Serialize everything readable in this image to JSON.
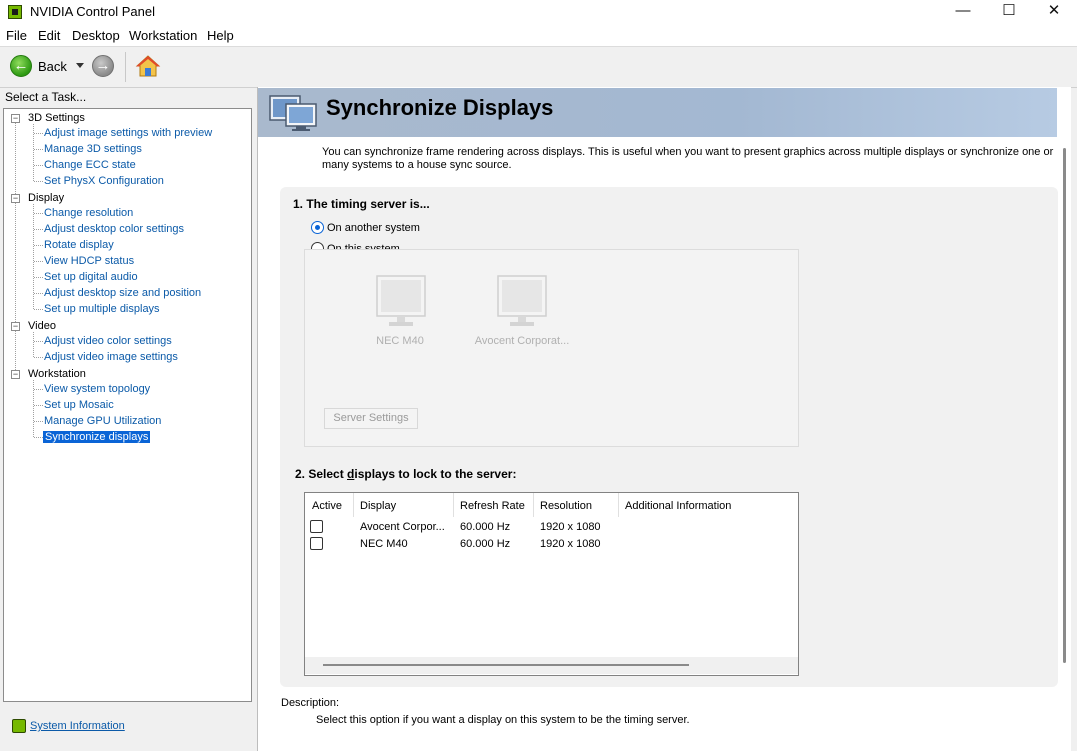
{
  "window": {
    "title": "NVIDIA Control Panel",
    "minimize_glyph": "—",
    "maximize_glyph": "☐",
    "close_glyph": "✕"
  },
  "menu": [
    "File",
    "Edit",
    "Desktop",
    "Workstation",
    "Help"
  ],
  "toolbar": {
    "back_label": "Back",
    "icons": [
      "back-arrow-icon",
      "dropdown-arrow-icon",
      "forward-arrow-icon",
      "home-icon"
    ]
  },
  "sidebar": {
    "task_label": "Select a Task...",
    "categories": [
      {
        "label": "3D Settings",
        "items": [
          "Adjust image settings with preview",
          "Manage 3D settings",
          "Change ECC state",
          "Set PhysX Configuration"
        ]
      },
      {
        "label": "Display",
        "items": [
          "Change resolution",
          "Adjust desktop color settings",
          "Rotate display",
          "View HDCP status",
          "Set up digital audio",
          "Adjust desktop size and position",
          "Set up multiple displays"
        ]
      },
      {
        "label": "Video",
        "items": [
          "Adjust video color settings",
          "Adjust video image settings"
        ]
      },
      {
        "label": "Workstation",
        "items": [
          "View system topology",
          "Set up Mosaic",
          "Manage GPU Utilization",
          "Synchronize displays"
        ]
      }
    ],
    "selected_item": "Synchronize displays",
    "expander_glyph": "−",
    "system_info_link": "System Information"
  },
  "page": {
    "title": "Synchronize Displays",
    "intro": "You can synchronize frame rendering across displays. This is useful when you want to present graphics across multiple displays or synchronize one or many systems to a house sync source.",
    "section1": {
      "title": "1. The timing server is...",
      "option_another": "On another system",
      "option_this": "On this system",
      "selected": "On another system",
      "displays": [
        "NEC M40",
        "Avocent Corporat..."
      ],
      "server_settings_button": "Server Settings"
    },
    "section2": {
      "title_prefix": "2. Select ",
      "title_underlined": "d",
      "title_suffix": "isplays to lock to the server:",
      "columns": [
        "Active",
        "Display",
        "Refresh Rate",
        "Resolution",
        "Additional Information"
      ],
      "rows": [
        {
          "active": false,
          "display": "Avocent Corpor...",
          "refresh": "60.000 Hz",
          "resolution": "1920 x 1080",
          "info": ""
        },
        {
          "active": false,
          "display": "NEC M40",
          "refresh": "60.000 Hz",
          "resolution": "1920 x 1080",
          "info": ""
        }
      ]
    },
    "description_label": "Description:",
    "description_text": "Select this option if you want a display on this system to be the timing server."
  },
  "colors": {
    "accent": "#0a64d6",
    "link": "#0b5aa8",
    "nvidia_green": "#76b900",
    "header_band": "#a9b9cd"
  }
}
